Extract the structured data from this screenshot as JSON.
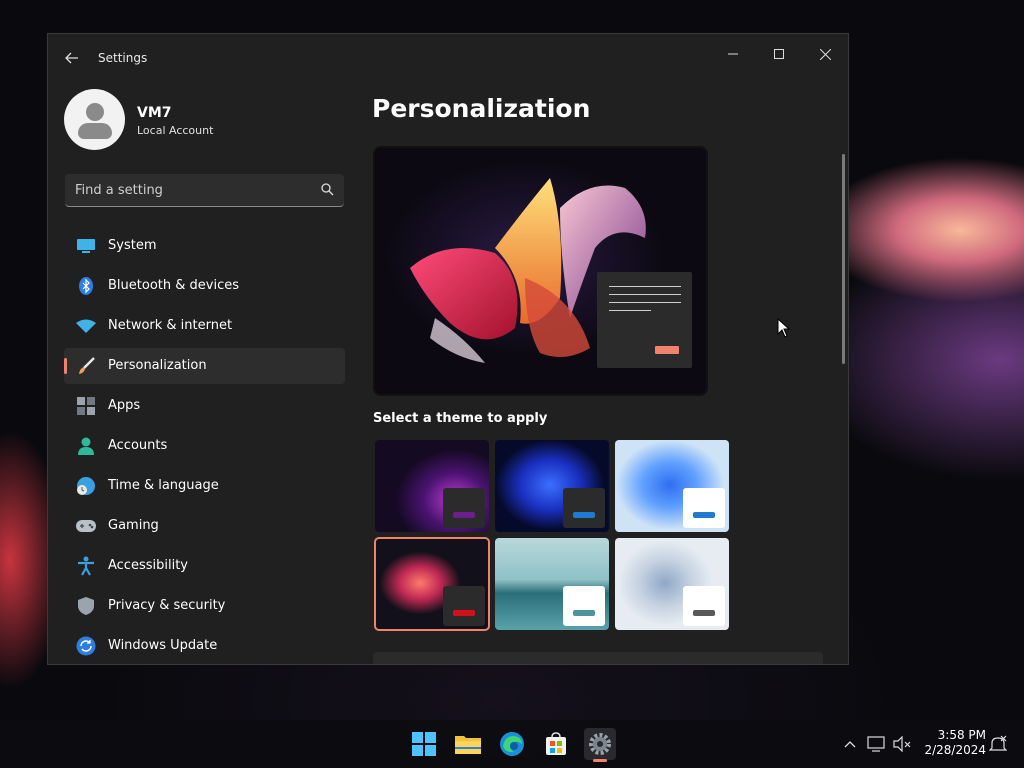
{
  "window": {
    "title": "Settings",
    "icons": {
      "back": "back-arrow-icon",
      "minimize": "minimize-icon",
      "maximize": "maximize-icon",
      "close": "close-icon"
    }
  },
  "profile": {
    "name": "VM7",
    "account_type": "Local Account"
  },
  "search": {
    "placeholder": "Find a setting"
  },
  "sidebar": {
    "items": [
      {
        "label": "System",
        "icon": "system-icon",
        "active": false
      },
      {
        "label": "Bluetooth & devices",
        "icon": "bluetooth-icon",
        "active": false
      },
      {
        "label": "Network & internet",
        "icon": "wifi-icon",
        "active": false
      },
      {
        "label": "Personalization",
        "icon": "paintbrush-icon",
        "active": true
      },
      {
        "label": "Apps",
        "icon": "apps-icon",
        "active": false
      },
      {
        "label": "Accounts",
        "icon": "accounts-icon",
        "active": false
      },
      {
        "label": "Time & language",
        "icon": "time-language-icon",
        "active": false
      },
      {
        "label": "Gaming",
        "icon": "gamepad-icon",
        "active": false
      },
      {
        "label": "Accessibility",
        "icon": "accessibility-icon",
        "active": false
      },
      {
        "label": "Privacy & security",
        "icon": "shield-icon",
        "active": false
      },
      {
        "label": "Windows Update",
        "icon": "update-icon",
        "active": false
      }
    ]
  },
  "main": {
    "title": "Personalization",
    "theme_section_label": "Select a theme to apply",
    "themes": [
      {
        "name": "dark-purple-glow",
        "accent": "#6b1f8c",
        "swatch_bg": "#2b2b2b",
        "selected": false
      },
      {
        "name": "dark-blue-bloom",
        "accent": "#1f7ad1",
        "swatch_bg": "#2b2b2b",
        "selected": false
      },
      {
        "name": "light-blue-bloom",
        "accent": "#1f7ad1",
        "swatch_bg": "#ffffff",
        "selected": false
      },
      {
        "name": "glow-flower",
        "accent": "#d0101a",
        "swatch_bg": "#2b2b2b",
        "selected": true
      },
      {
        "name": "captured-motion-lake",
        "accent": "#4d93a0",
        "swatch_bg": "#ffffff",
        "selected": false
      },
      {
        "name": "flow-light",
        "accent": "#5a5a5a",
        "swatch_bg": "#ffffff",
        "selected": false
      }
    ]
  },
  "taskbar": {
    "apps": [
      {
        "name": "start-icon",
        "active": false
      },
      {
        "name": "file-explorer-icon",
        "active": false
      },
      {
        "name": "edge-icon",
        "active": false
      },
      {
        "name": "store-icon",
        "active": false
      },
      {
        "name": "settings-gear-icon",
        "active": true
      }
    ],
    "tray_icons": [
      "chevron-up-icon",
      "network-icon",
      "volume-muted-icon",
      "notification-icon"
    ],
    "time": "3:58 PM",
    "date": "2/28/2024"
  },
  "colors": {
    "accent": "#f0826e",
    "window_bg": "#202020",
    "panel_bg": "#2d2d2d"
  }
}
